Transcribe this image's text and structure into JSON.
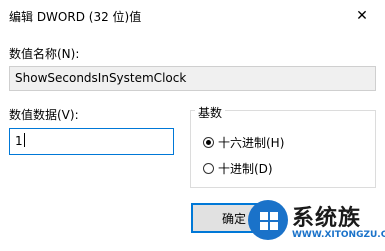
{
  "window": {
    "title": "编辑 DWORD (32 位)值",
    "close_symbol": "✕"
  },
  "value_name": {
    "label": "数值名称(N):",
    "value": "ShowSecondsInSystemClock"
  },
  "value_data": {
    "label": "数值数据(V):",
    "value": "1"
  },
  "base": {
    "title": "基数",
    "options": [
      {
        "label": "十六进制(H)",
        "selected": true
      },
      {
        "label": "十进制(D)",
        "selected": false
      }
    ]
  },
  "buttons": {
    "ok_label": "确定"
  },
  "watermark": {
    "text": "系统族",
    "url": "WWW.XITONGZU.COM"
  },
  "colors": {
    "accent": "#0078d7",
    "watermark_blue": "#1a72c9"
  }
}
